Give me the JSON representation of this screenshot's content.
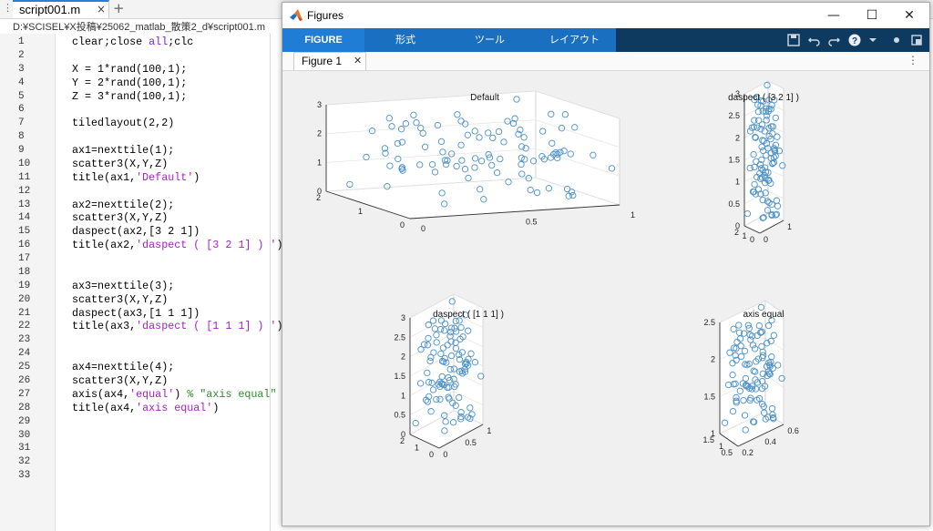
{
  "editor": {
    "tab_menu_icon": "⋮",
    "tab_title": "script001.m",
    "tab_close": "×",
    "tab_add": "+",
    "file_path": "D:¥SCISEL¥X投稿¥25062_matlab_散策2_d¥script001.m",
    "lines": [
      [
        [
          "clear;close ",
          ""
        ],
        [
          "all",
          "kw"
        ],
        [
          ";clc",
          ""
        ]
      ],
      [],
      [
        [
          "X = 1*rand(100,1);",
          ""
        ]
      ],
      [
        [
          "Y = 2*rand(100,1);",
          ""
        ]
      ],
      [
        [
          "Z = 3*rand(100,1);",
          ""
        ]
      ],
      [],
      [
        [
          "tiledlayout(2,2)",
          ""
        ]
      ],
      [],
      [
        [
          "ax1=nexttile(1);",
          ""
        ]
      ],
      [
        [
          "scatter3(X,Y,Z)",
          ""
        ]
      ],
      [
        [
          "title(ax1,",
          ""
        ],
        [
          "'Default'",
          "str"
        ],
        [
          ")",
          ""
        ]
      ],
      [],
      [
        [
          "ax2=nexttile(2);",
          ""
        ]
      ],
      [
        [
          "scatter3(X,Y,Z)",
          ""
        ]
      ],
      [
        [
          "daspect(ax2,[3 2 1])",
          ""
        ]
      ],
      [
        [
          "title(ax2,",
          ""
        ],
        [
          "'daspect ( [3 2 1] ) '",
          "str"
        ],
        [
          ")",
          ""
        ]
      ],
      [],
      [],
      [
        [
          "ax3=nexttile(3);",
          ""
        ]
      ],
      [
        [
          "scatter3(X,Y,Z)",
          ""
        ]
      ],
      [
        [
          "daspect(ax3,[1 1 1])",
          ""
        ]
      ],
      [
        [
          "title(ax3,",
          ""
        ],
        [
          "'daspect ( [1 1 1] ) '",
          "str"
        ],
        [
          ")",
          ""
        ]
      ],
      [],
      [],
      [
        [
          "ax4=nexttile(4);",
          ""
        ]
      ],
      [
        [
          "scatter3(X,Y,Z)",
          ""
        ]
      ],
      [
        [
          "axis(ax4,",
          ""
        ],
        [
          "'equal'",
          "str"
        ],
        [
          ") ",
          ""
        ],
        [
          "% \"axis equal\"",
          "cmt"
        ]
      ],
      [
        [
          "title(ax4,",
          ""
        ],
        [
          "'axis equal'",
          "str"
        ],
        [
          ")",
          ""
        ]
      ],
      [],
      [],
      [],
      [],
      []
    ]
  },
  "figures_window": {
    "title": "Figures",
    "minimize": "—",
    "maximize": "☐",
    "close": "✕",
    "ribbon_tabs": [
      "FIGURE",
      "形式",
      "ツール",
      "レイアウト"
    ],
    "ribbon_icons": [
      "save-icon",
      "undo-icon",
      "redo-icon",
      "help-icon",
      "pin-icon",
      "dock-icon"
    ],
    "figure_tab": "Figure 1",
    "figure_tab_close": "✕",
    "figure_menu": "⋮"
  },
  "plots": [
    {
      "title": "Default",
      "z_ticks": [
        "0",
        "1",
        "2",
        "3"
      ],
      "y_ticks": [
        "0",
        "1",
        "2"
      ],
      "x_ticks": [
        "0",
        "0.5",
        "1"
      ]
    },
    {
      "title": "daspect ( [3 2 1] )",
      "z_ticks": [
        "0",
        "0.5",
        "1",
        "1.5",
        "2",
        "2.5",
        "3"
      ],
      "y_ticks": [
        "0",
        "1",
        "2"
      ],
      "x_ticks": [
        "0",
        "1"
      ]
    },
    {
      "title": "daspect ( [1 1 1] )",
      "z_ticks": [
        "0",
        "0.5",
        "1",
        "1.5",
        "2",
        "2.5",
        "3"
      ],
      "y_ticks": [
        "0",
        "1",
        "2"
      ],
      "x_ticks": [
        "0",
        "0.5",
        "1"
      ]
    },
    {
      "title": "axis equal",
      "z_ticks": [
        "1",
        "1.5",
        "2",
        "2.5"
      ],
      "y_ticks": [
        "0.5",
        "1",
        "1.5"
      ],
      "x_ticks": [
        "0.2",
        "0.4",
        "0.6"
      ]
    }
  ],
  "colors": {
    "marker": "#4a90c8",
    "ribbon_tabs": "#1b6fc0",
    "ribbon_bar": "#0f3a5f",
    "keyword": "#7b1fd2",
    "string": "#a61fc7",
    "comment": "#2e8b2e"
  }
}
